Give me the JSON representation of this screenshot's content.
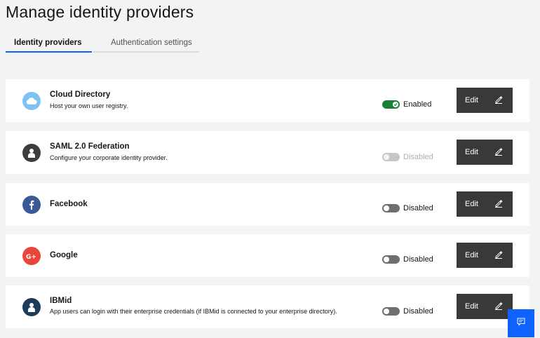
{
  "page": {
    "title": "Manage identity providers"
  },
  "tabs": [
    {
      "label": "Identity providers",
      "active": true
    },
    {
      "label": "Authentication settings",
      "active": false
    }
  ],
  "providers": [
    {
      "name": "Cloud Directory",
      "description": "Host your own user registry.",
      "status": "Enabled",
      "toggle": "on",
      "icon": "cloud-icon",
      "icon_color": "#7cc3f4",
      "edit_label": "Edit"
    },
    {
      "name": "SAML 2.0 Federation",
      "description": "Configure your corporate identity provider.",
      "status": "Disabled",
      "toggle": "disabled",
      "icon": "user-icon",
      "icon_color": "#3d3d3d",
      "edit_label": "Edit"
    },
    {
      "name": "Facebook",
      "description": "",
      "status": "Disabled",
      "toggle": "off",
      "icon": "facebook-icon",
      "icon_color": "#3b5998",
      "edit_label": "Edit"
    },
    {
      "name": "Google",
      "description": "",
      "status": "Disabled",
      "toggle": "off",
      "icon": "google-plus-icon",
      "icon_color": "#e8453c",
      "edit_label": "Edit"
    },
    {
      "name": "IBMid",
      "description": "App users can login with their enterprise credentials (if IBMid is connected to your enterprise directory).",
      "status": "Disabled",
      "toggle": "off",
      "icon": "user-icon",
      "icon_color": "#1d3c5a",
      "edit_label": "Edit"
    }
  ],
  "feedback": {
    "icon": "chat-icon",
    "color": "#0f62fe"
  }
}
